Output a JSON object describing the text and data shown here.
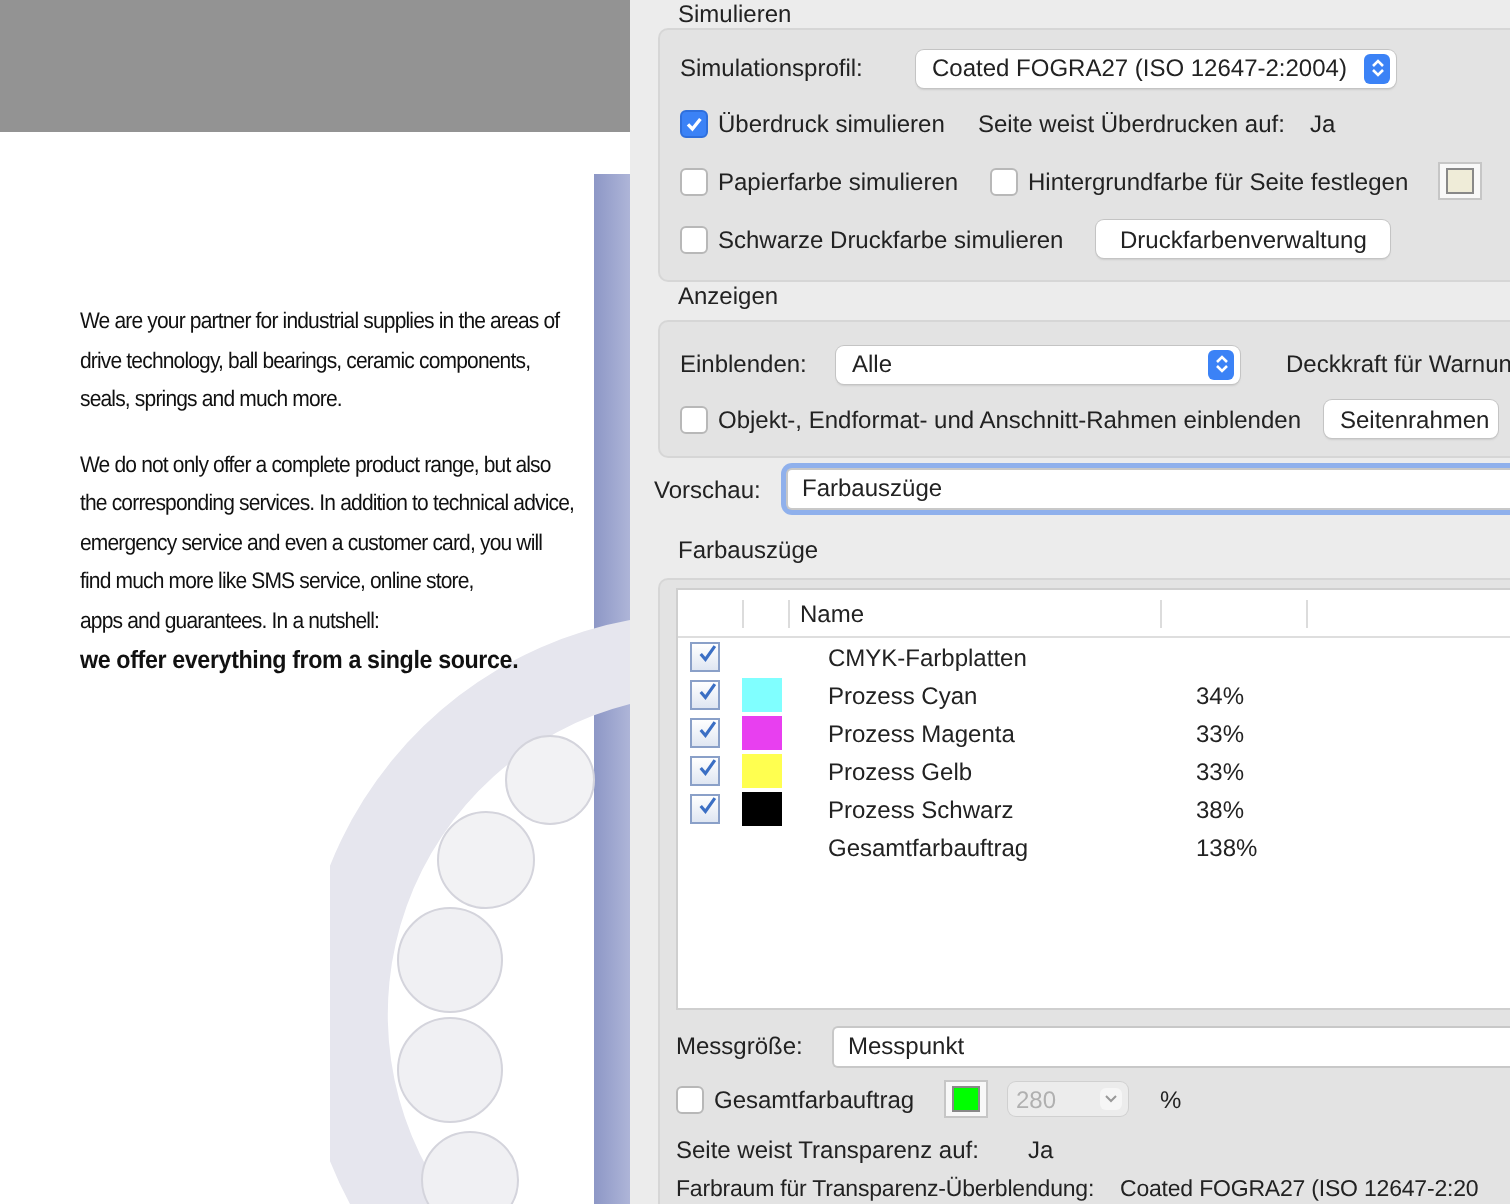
{
  "document": {
    "paragraphs": [
      {
        "lines": [
          "We are your partner for industrial supplies in the areas of",
          "drive technology, ball bearings, ceramic components,",
          "seals, springs and much more."
        ]
      },
      {
        "lines": [
          "We do not only offer a complete product range, but also",
          "the corresponding services. In addition to technical advice,",
          "emergency service and even a customer card, you will",
          "find much more like SMS service, online store,",
          "apps and guarantees. In a nutshell:"
        ],
        "emphasis": "we offer everything from a single source."
      }
    ]
  },
  "simulieren": {
    "title": "Simulieren",
    "profile_label": "Simulationsprofil:",
    "profile_value": "Coated FOGRA27 (ISO 12647-2:2004)",
    "overprint": {
      "label": "Überdruck simulieren",
      "checked": true
    },
    "overprint_info_label": "Seite weist Überdrucken auf:",
    "overprint_info_value": "Ja",
    "paper": {
      "label": "Papierfarbe simulieren",
      "checked": false
    },
    "background": {
      "label": "Hintergrundfarbe für Seite festlegen",
      "checked": false,
      "color": "#efecd8"
    },
    "black_ink": {
      "label": "Schwarze Druckfarbe simulieren",
      "checked": false
    },
    "ink_button": "Druckfarbenverwaltung"
  },
  "anzeigen": {
    "title": "Anzeigen",
    "show_label": "Einblenden:",
    "show_value": "Alle",
    "opacity_label": "Deckkraft für Warnun",
    "frames": {
      "label": "Objekt-, Endformat- und Anschnitt-Rahmen einblenden",
      "checked": false
    },
    "frames_button": "Seitenrahmen"
  },
  "preview": {
    "label": "Vorschau:",
    "value": "Farbauszüge"
  },
  "separations": {
    "title": "Farbauszüge",
    "name_heading": "Name",
    "rows": [
      {
        "kind": "plate",
        "checked": true,
        "name": "CMYK-Farbplatten"
      },
      {
        "kind": "plate",
        "checked": true,
        "color": "#80ffff",
        "name": "Prozess Cyan",
        "value": "34%"
      },
      {
        "kind": "plate",
        "checked": true,
        "color": "#e83ff0",
        "name": "Prozess Magenta",
        "value": "33%"
      },
      {
        "kind": "plate",
        "checked": true,
        "color": "#ffff50",
        "name": "Prozess Gelb",
        "value": "33%"
      },
      {
        "kind": "plate",
        "checked": true,
        "color": "#000000",
        "name": "Prozess Schwarz",
        "value": "38%"
      },
      {
        "kind": "total",
        "name": "Gesamtfarbauftrag",
        "value": "138%"
      }
    ]
  },
  "measure": {
    "label": "Messgröße:",
    "value": "Messpunkt"
  },
  "total_ink": {
    "label": "Gesamtfarbauftrag",
    "checked": false,
    "color": "#00ff00",
    "value": "280",
    "disabled": true,
    "unit": "%"
  },
  "transparency": {
    "label": "Seite weist Transparenz auf:",
    "value": "Ja"
  },
  "blend_space": {
    "label": "Farbraum für Transparenz-Überblendung:",
    "value": "Coated FOGRA27 (ISO 12647-2:20"
  }
}
